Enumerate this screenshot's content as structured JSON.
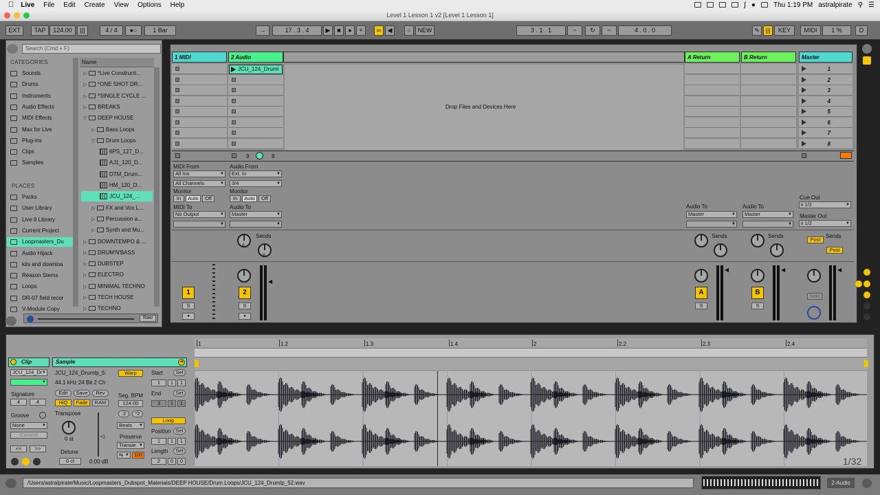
{
  "menubar": {
    "app": "Live",
    "items": [
      "File",
      "Edit",
      "Create",
      "View",
      "Options",
      "Help"
    ],
    "clock": "Thu 1:19 PM",
    "user": "astralpirate"
  },
  "window": {
    "title": "Level 1 Lesson 1 v2  [Level 1 Lesson 1]"
  },
  "control": {
    "ext": "EXT",
    "tap": "TAP",
    "tempo": "124.00",
    "sig": "4 / 4",
    "quant": "1 Bar",
    "pos": "17 .  3 .  4",
    "new": "NEW",
    "loop_start": "3 .  1 .  1",
    "loop_len": "4 .  0 .  0",
    "key": "KEY",
    "midi": "MIDI",
    "cpu": "1 %",
    "d": "D"
  },
  "browser": {
    "search_placeholder": "Search (Cmd + F)",
    "categories_header": "CATEGORIES",
    "categories": [
      "Sounds",
      "Drums",
      "Instruments",
      "Audio Effects",
      "MIDI Effects",
      "Max for Live",
      "Plug-ins",
      "Clips",
      "Samples"
    ],
    "places_header": "PLACES",
    "places": [
      "Packs",
      "User Library",
      "Live 8 Library",
      "Current Project",
      "Loopmasters_Du",
      "Audio Hijack",
      "kits and downloa",
      "Reason Stems",
      "Loops",
      "DR-07 field recor",
      "V-Module Copy"
    ],
    "name_header": "Name",
    "files": [
      {
        "name": "*Live Constructi...",
        "type": "folder",
        "depth": 0
      },
      {
        "name": "*ONE SHOT DR...",
        "type": "folder",
        "depth": 0
      },
      {
        "name": "*SINGLE CYCLE ...",
        "type": "folder",
        "depth": 0
      },
      {
        "name": "BREAKS",
        "type": "folder",
        "depth": 0
      },
      {
        "name": "DEEP HOUSE",
        "type": "folder-open",
        "depth": 0
      },
      {
        "name": "Bass Loops",
        "type": "folder",
        "depth": 1
      },
      {
        "name": "Drum Loops",
        "type": "folder-open",
        "depth": 1
      },
      {
        "name": "6PS_127_D...",
        "type": "wav",
        "depth": 2
      },
      {
        "name": "AJ1_120_D...",
        "type": "wav",
        "depth": 2
      },
      {
        "name": "DTM_Drum...",
        "type": "wav",
        "depth": 2
      },
      {
        "name": "HM_120_D...",
        "type": "wav",
        "depth": 2
      },
      {
        "name": "JCU_124_...",
        "type": "wav",
        "depth": 2
      },
      {
        "name": "FX and Vox L...",
        "type": "folder",
        "depth": 1
      },
      {
        "name": "Percussion a...",
        "type": "folder",
        "depth": 1
      },
      {
        "name": "Synth and Mu...",
        "type": "folder",
        "depth": 1
      },
      {
        "name": "DOWNTEMPO & ...",
        "type": "folder",
        "depth": 0
      },
      {
        "name": "DRUM'N'BASS",
        "type": "folder",
        "depth": 0
      },
      {
        "name": "DUBSTEP",
        "type": "folder",
        "depth": 0
      },
      {
        "name": "ELECTRO",
        "type": "folder",
        "depth": 0
      },
      {
        "name": "MINIMAL TECHNO",
        "type": "folder",
        "depth": 0
      },
      {
        "name": "TECH HOUSE",
        "type": "folder",
        "depth": 0
      },
      {
        "name": "TECHNO",
        "type": "folder",
        "depth": 0
      }
    ],
    "raw": "Raw"
  },
  "session": {
    "tracks": [
      {
        "name": "1 MIDI",
        "color": "#4fd8d0"
      },
      {
        "name": "2 Audio",
        "color": "#48f08c"
      },
      {
        "name": "A Return",
        "color": "#6cf05c"
      },
      {
        "name": "B Return",
        "color": "#6cf05c"
      },
      {
        "name": "Master",
        "color": "#4fd8d0"
      }
    ],
    "clip_name": "JCU_124_Druml",
    "drop_text": "Drop Files and Devices Here",
    "scenes": [
      "1",
      "2",
      "3",
      "4",
      "5",
      "6",
      "7",
      "8"
    ],
    "midi_io": {
      "from_label": "MIDI From",
      "from": "All Ins",
      "channel": "All Channels",
      "monitor": "Monitor",
      "in": "In",
      "auto": "Auto",
      "off": "Off",
      "to_label": "MIDI To",
      "to": "No Output"
    },
    "audio_io": {
      "from_label": "Audio From",
      "from": "Ext. In",
      "channel": "3/4",
      "monitor": "Monitor",
      "in": "In",
      "auto": "Auto",
      "off": "Off",
      "to_label": "Audio To",
      "to": "Master"
    },
    "return_a": {
      "to_label": "Audio To",
      "to": "Master",
      "btn": "A",
      "s": "S"
    },
    "return_b": {
      "to_label": "Audio To",
      "to": "Master",
      "btn": "B",
      "s": "S"
    },
    "master": {
      "cue_label": "Cue Out",
      "cue": "ii 1/2",
      "out_label": "Master Out",
      "out": "ii 1/2",
      "post": "Post",
      "solo": "Solo"
    },
    "sends": "Sends",
    "knob_a": "A",
    "knob_b": "B",
    "track1": {
      "num": "1",
      "s": "S"
    },
    "track2": {
      "num": "2",
      "s": "S",
      "n9": "9",
      "n8": "8"
    }
  },
  "clip": {
    "clip_label": "Clip",
    "name": "JCU_124_Dr",
    "signature_label": "Signature",
    "sig_num": "4",
    "sig_den": "4",
    "groove_label": "Groove",
    "groove": "None",
    "commit": "Commit",
    "sample_label": "Sample",
    "sample_name": "JCU_124_Drumlp_5:",
    "sample_info": "44.1 kHz 24 Bit 2 Ch",
    "edit": "Edit",
    "save": "Save",
    "rev": "Rev",
    "hiq": "HiQ",
    "fade": "Fade",
    "ram": "RAM",
    "transpose_label": "Transpose",
    "transpose": "0 st",
    "detune_label": "Detune",
    "detune": "0 ct",
    "gain": "0.00 dB",
    "warp": "Warp",
    "seg_bpm_label": "Seg. BPM",
    "seg_bpm": "124.00",
    "half": ":2",
    "dbl": "*2",
    "warp_mode": "Beats",
    "preserve_label": "Preserve",
    "preserve": "Transie",
    "env": "100",
    "start_label": "Start",
    "end_label": "End",
    "loop": "Loop",
    "position_label": "Position",
    "length_label": "Length",
    "set": "Set",
    "start": [
      "1",
      "1",
      "1"
    ],
    "end": [
      "3",
      "1",
      "1"
    ],
    "position": [
      "1",
      "1",
      "1"
    ],
    "length": [
      "2",
      "0",
      "0"
    ],
    "ruler": [
      "1",
      "1.2",
      "1.3",
      "1.4",
      "2",
      "2.2",
      "2.3",
      "2.4"
    ],
    "zoom": "1/32"
  },
  "status": {
    "path": "/Users/astralpirate/Music/Loopmasters_Dubspot_Materials/DEEP HOUSE/Drum Loops/JCU_124_Drumlp_52.wav",
    "track": "2-Audio"
  }
}
